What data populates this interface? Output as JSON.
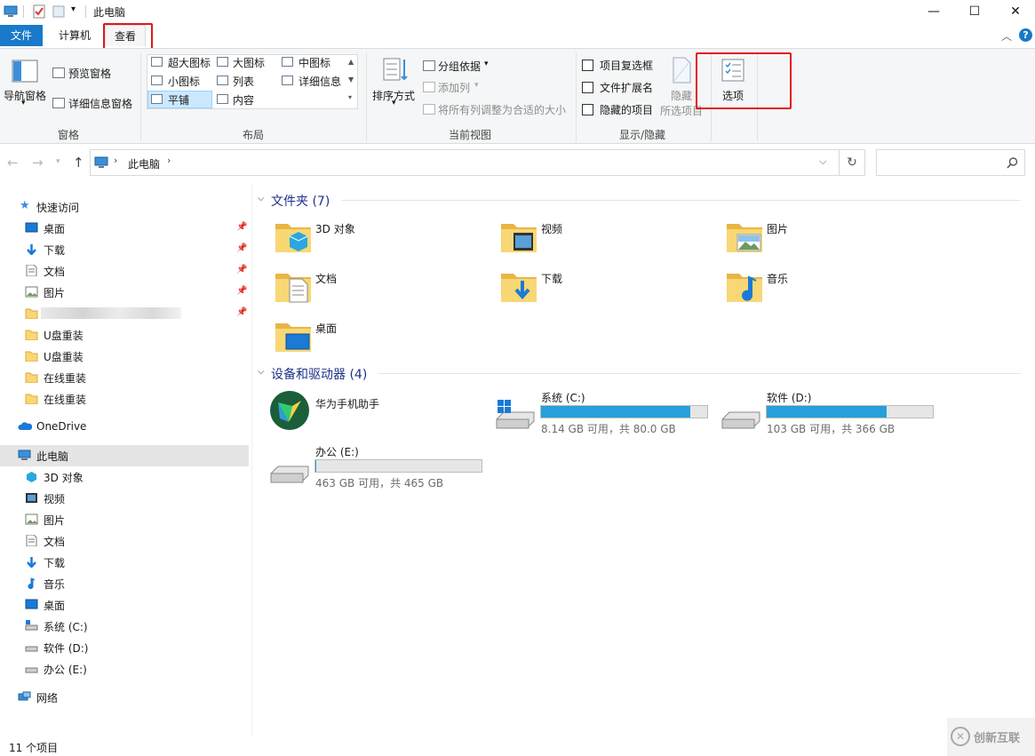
{
  "title_bar": {
    "title": "此电脑"
  },
  "ribbon": {
    "tabs": {
      "file": "文件",
      "computer": "计算机",
      "view": "查看"
    },
    "pane_group": {
      "nav_pane": "导航窗格",
      "preview_pane": "预览窗格",
      "details_pane": "详细信息窗格",
      "label": "窗格"
    },
    "layout_group": {
      "extra_large": "超大图标",
      "large": "大图标",
      "medium": "中图标",
      "small": "小图标",
      "list": "列表",
      "details": "详细信息",
      "tiles": "平铺",
      "content": "内容",
      "label": "布局"
    },
    "current_view_group": {
      "sort_by": "排序方式",
      "group_by": "分组依据",
      "add_columns": "添加列",
      "size_all": "将所有列调整为合适的大小",
      "label": "当前视图"
    },
    "show_hide_group": {
      "item_checkboxes": "项目复选框",
      "file_extensions": "文件扩展名",
      "hidden_items": "隐藏的项目",
      "hide_selected_1": "隐藏",
      "hide_selected_2": "所选项目",
      "label": "显示/隐藏"
    },
    "options": "选项"
  },
  "address": {
    "location": "此电脑"
  },
  "nav": {
    "quick_access": "快速访问",
    "quick_items": [
      {
        "label": "桌面",
        "pinned": true
      },
      {
        "label": "下载",
        "pinned": true
      },
      {
        "label": "文档",
        "pinned": true
      },
      {
        "label": "图片",
        "pinned": true
      },
      {
        "label": "",
        "pinned": true
      },
      {
        "label": "U盘重装"
      },
      {
        "label": "U盘重装"
      },
      {
        "label": "在线重装"
      },
      {
        "label": "在线重装"
      }
    ],
    "onedrive": "OneDrive",
    "this_pc": "此电脑",
    "pc_items": [
      "3D 对象",
      "视频",
      "图片",
      "文档",
      "下载",
      "音乐",
      "桌面",
      "系统 (C:)",
      "软件 (D:)",
      "办公 (E:)"
    ],
    "network": "网络"
  },
  "content": {
    "folders_header": "文件夹 (7)",
    "folders": [
      "3D 对象",
      "视频",
      "图片",
      "文档",
      "下载",
      "音乐",
      "桌面"
    ],
    "devices_header": "设备和驱动器 (4)",
    "devices": {
      "phone": "华为手机助手",
      "c": {
        "name": "系统 (C:)",
        "info": "8.14 GB 可用，共 80.0 GB",
        "used_fraction": 0.9
      },
      "d": {
        "name": "软件 (D:)",
        "info": "103 GB 可用，共 366 GB",
        "used_fraction": 0.72
      },
      "e": {
        "name": "办公 (E:)",
        "info": "463 GB 可用，共 465 GB",
        "used_fraction": 0.004
      }
    }
  },
  "status": {
    "count": "11 个项目"
  },
  "watermark": "创新互联"
}
